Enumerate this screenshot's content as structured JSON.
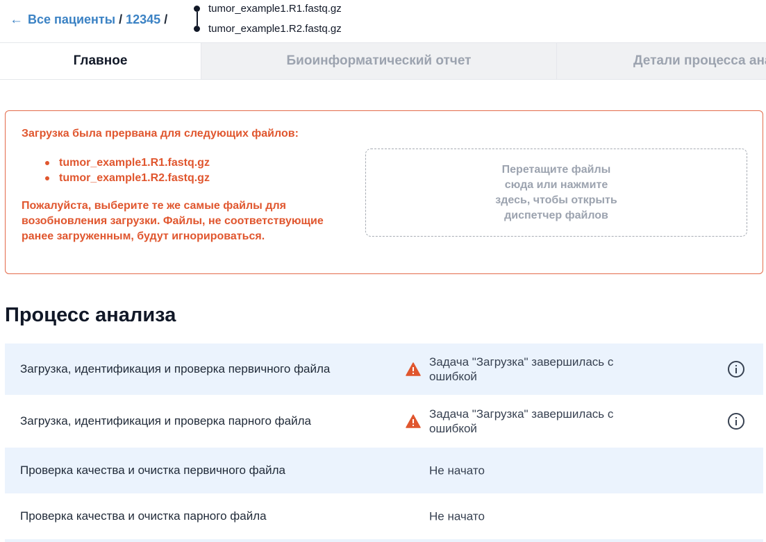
{
  "breadcrumb": {
    "back_label": "Все пациенты",
    "separator": "/",
    "patient_id": "12345",
    "files": [
      "tumor_example1.R1.fastq.gz",
      "tumor_example1.R2.fastq.gz"
    ]
  },
  "tabs": [
    {
      "label": "Главное",
      "active": true
    },
    {
      "label": "Биоинформатический отчет",
      "active": false
    },
    {
      "label": "Детали процесса анализа",
      "active": false
    }
  ],
  "alert": {
    "title": "Загрузка была прервана для следующих файлов:",
    "files": [
      "tumor_example1.R1.fastq.gz",
      "tumor_example1.R2.fastq.gz"
    ],
    "message": "Пожалуйста, выберите те же самые файлы для возобновления загрузки. Файлы, не соответствующие ранее загруженным, будут игнорироваться.",
    "dropzone_text": "Перетащите файлы сюда или нажмите здесь, чтобы открыть диспетчер файлов",
    "color": "#e0562e"
  },
  "process": {
    "title": "Процесс анализа",
    "steps": [
      {
        "name": "Загрузка, идентификация и проверка первичного файла",
        "status": "Задача \"Загрузка\" завершилась с ошибкой",
        "icon": "warning-icon"
      },
      {
        "name": "Загрузка, идентификация и проверка парного файла",
        "status": "Задача \"Загрузка\" завершилась с ошибкой",
        "icon": "warning-icon"
      },
      {
        "name": "Проверка качества и очистка первичного файла",
        "status": "Не начато"
      },
      {
        "name": "Проверка качества и очистка парного файла",
        "status": "Не начато"
      }
    ]
  },
  "colors": {
    "link": "#3b82c4",
    "error": "#e0562e",
    "row_shade": "#ebf3fd",
    "tab_inactive_bg": "#f0f1f3"
  }
}
